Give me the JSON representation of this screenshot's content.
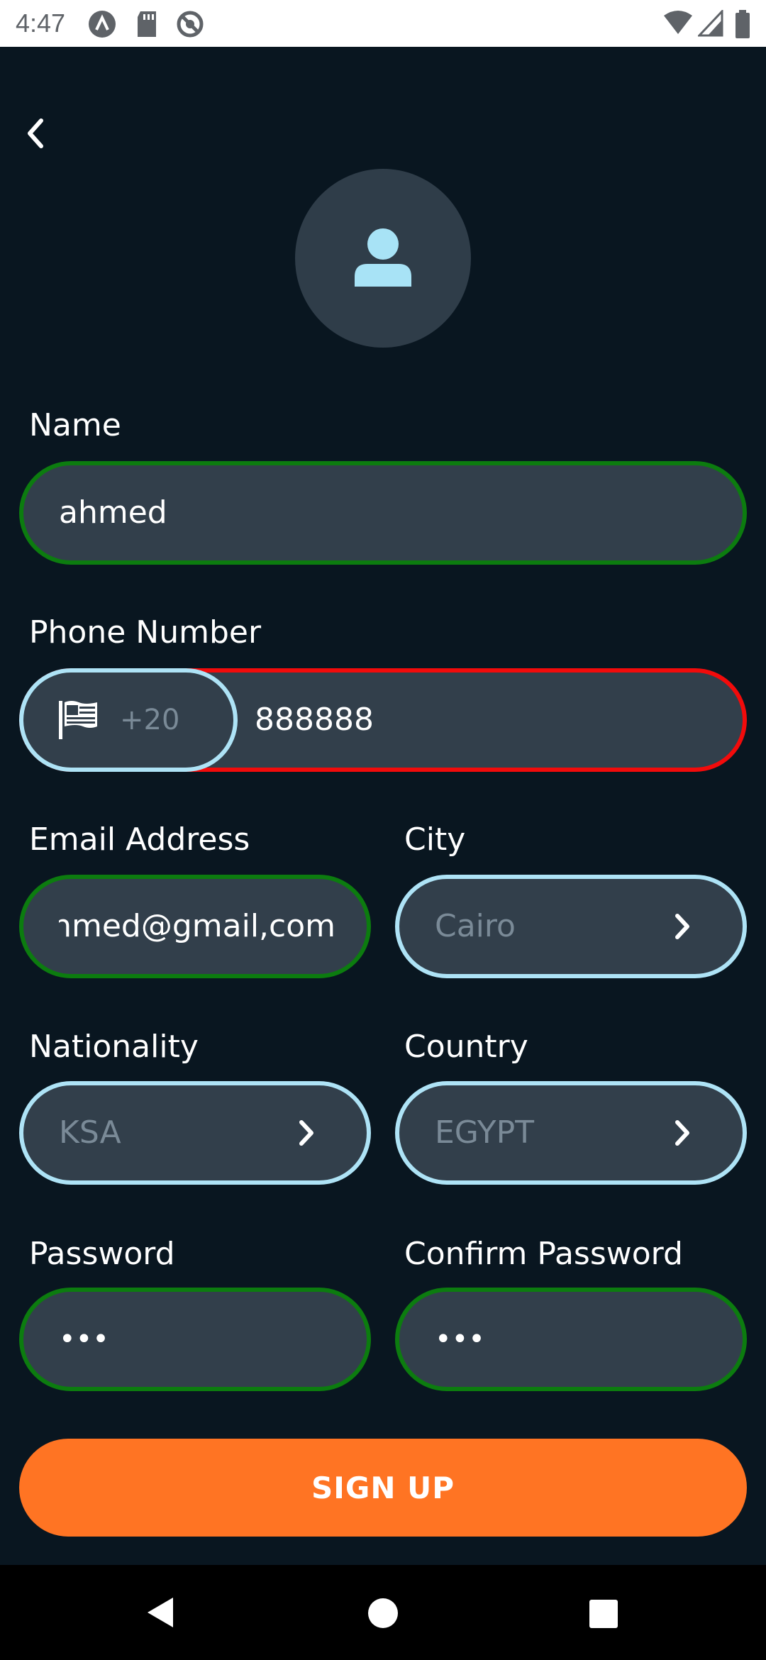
{
  "status_bar": {
    "time": "4:47",
    "left_icons": [
      "app-a-icon",
      "sd-card-icon",
      "no-sync-icon"
    ],
    "right_icons": [
      "wifi-icon",
      "cell-signal-icon",
      "battery-icon"
    ]
  },
  "header": {
    "back_icon": "chevron-left-icon"
  },
  "avatar": {
    "icon": "person-icon"
  },
  "form": {
    "name": {
      "label": "Name",
      "value": "ahmed"
    },
    "phone": {
      "label": "Phone Number",
      "country_code": "+20",
      "flag_icon": "flag-icon",
      "value": "888888"
    },
    "email": {
      "label": "Email Address",
      "value": "ahmed@gmail,com"
    },
    "city": {
      "label": "City",
      "placeholder": "Cairo"
    },
    "nationality": {
      "label": "Nationality",
      "placeholder": "KSA"
    },
    "country": {
      "label": "Country",
      "placeholder": "EGYPT"
    },
    "password": {
      "label": "Password",
      "value": "•••"
    },
    "confirm_password": {
      "label": "Confirm Password",
      "value": "•••"
    }
  },
  "signup_label": "SIGN UP",
  "colors": {
    "background": "#091620",
    "field_bg": "#323f4b",
    "valid_border": "#0c7c0f",
    "invalid_border": "#f20b0b",
    "neutral_border": "#aee3f6",
    "primary_button": "#ff7423"
  },
  "nav_bar": {
    "icons": [
      "back-triangle-icon",
      "home-circle-icon",
      "recents-square-icon"
    ]
  }
}
